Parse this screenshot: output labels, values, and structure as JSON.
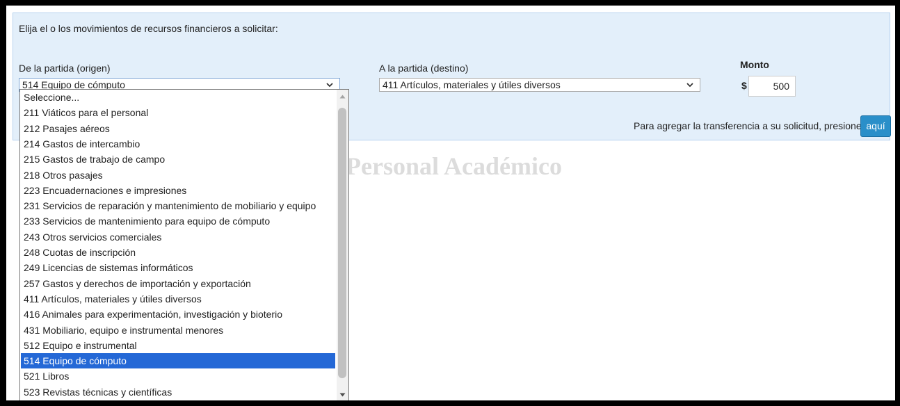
{
  "background": {
    "title": "Personal Académico"
  },
  "form": {
    "prompt": "Elija el o los movimientos de recursos financieros a solicitar:",
    "origin_label": "De la partida (origen)",
    "origin_selected": "514 Equipo de cómputo",
    "dest_label": "A la partida (destino)",
    "dest_selected": "411 Artículos, materiales y útiles diversos",
    "amount_label": "Monto",
    "currency": "$",
    "amount_value": "500",
    "hint": "Para agregar la transferencia a su solicitud, presione",
    "add_button": "aquí"
  },
  "dropdown": {
    "selected_index": 18,
    "options": [
      "Seleccione...",
      "211 Viáticos para el personal",
      "212 Pasajes aéreos",
      "214 Gastos de intercambio",
      "215 Gastos de trabajo de campo",
      "218 Otros pasajes",
      "223 Encuadernaciones e impresiones",
      "231 Servicios de reparación y mantenimiento de mobiliario y equipo",
      "233 Servicios de mantenimiento para equipo de cómputo",
      "243 Otros servicios comerciales",
      "248 Cuotas de inscripción",
      "249 Licencias de sistemas informáticos",
      "257 Gastos y derechos de importación y exportación",
      "411 Artículos, materiales y útiles diversos",
      "416 Animales para experimentación, investigación y bioterio",
      "431 Mobiliario, equipo e instrumental menores",
      "512 Equipo e instrumental",
      "514 Equipo de cómputo",
      "521 Libros",
      "523 Revistas técnicas y científicas"
    ]
  },
  "colors": {
    "panel_bg": "#e3effa",
    "accent": "#2a8fc9",
    "selection": "#2468d6"
  }
}
